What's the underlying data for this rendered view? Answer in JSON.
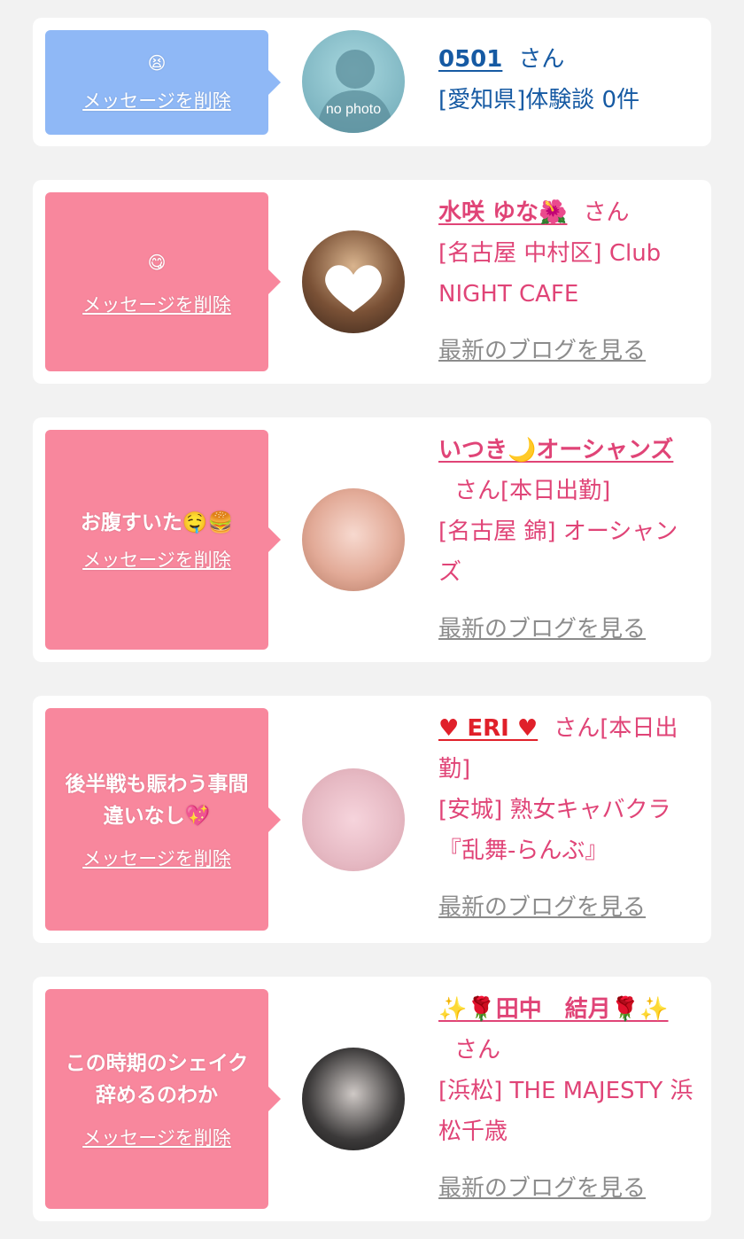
{
  "messages": [
    {
      "message": "😫",
      "delete_label": "メッセージを削除",
      "avatar_text": "no photo",
      "name": "0501",
      "san": "さん",
      "status": "",
      "location": "[愛知県]体験談 0件",
      "blog_label": ""
    },
    {
      "message": "😋 ",
      "delete_label": "メッセージを削除",
      "name": "水咲 ゆな🌺",
      "san": "さん",
      "status": "",
      "location": "[名古屋 中村区] Club NIGHT CAFE",
      "blog_label": "最新のブログを見る"
    },
    {
      "message": "お腹すいた🤤🍔",
      "delete_label": "メッセージを削除",
      "name": "いつき🌙オーシャンズ",
      "san": "さん",
      "status": "[本日出勤]",
      "location": "[名古屋 錦] オーシャンズ",
      "blog_label": "最新のブログを見る"
    },
    {
      "message": "後半戦も賑わう事間違いなし💖",
      "delete_label": "メッセージを削除",
      "name": "♥ ERI ♥",
      "san": "さん",
      "status": "[本日出勤]",
      "location": "[安城] 熟女キャバクラ『乱舞-らんぶ』",
      "blog_label": "最新のブログを見る"
    },
    {
      "message": "この時期のシェイク辞めるのわか",
      "delete_label": "メッセージを削除",
      "name": "✨🌹田中　結月🌹✨",
      "san": "さん",
      "status": "",
      "location": "[浜松] THE MAJESTY 浜松千歳",
      "blog_label": "最新のブログを見る"
    }
  ],
  "colors": {
    "bubble_blue": "#8fb8f6",
    "bubble_pink": "#f8879d",
    "text_blue": "#165aa3",
    "text_pink": "#e04477",
    "link_gray": "#8c8c8c",
    "background": "#f2f2f2"
  }
}
